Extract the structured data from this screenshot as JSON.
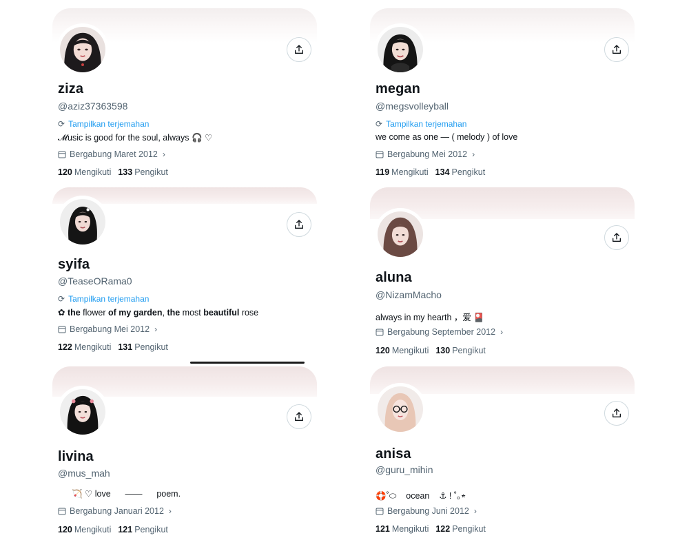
{
  "translate_label": "Tampilkan terjemahan",
  "following_label": "Mengikuti",
  "followers_label": "Pengikut",
  "icons": {
    "share": "share-icon",
    "translate": "translate-icon",
    "calendar": "calendar-icon",
    "chevron": "chevron-right-icon"
  },
  "profiles": [
    {
      "name": "ziza",
      "handle": "@aziz37363598",
      "bio": "𝓜usic is good for the soul, always 🎧 ♡",
      "joined": "Bergabung Maret 2012",
      "following": "120",
      "followers": "133"
    },
    {
      "name": "megan",
      "handle": "@megsvolleyball",
      "bio": "we come as one — ( melody ) of love",
      "joined": "Bergabung Mei 2012",
      "following": "119",
      "followers": "134"
    },
    {
      "name": "syifa",
      "handle": "@TeaseORama0",
      "bio_parts": [
        "✿ ",
        "the",
        " flower ",
        "of my garden",
        ", ",
        "the",
        " most ",
        "beautiful",
        " rose"
      ],
      "joined": "Bergabung Mei 2012",
      "following": "122",
      "followers": "131"
    },
    {
      "name": "aluna",
      "handle": "@NizamMacho",
      "bio": "always in my hearth ，爱 🎴",
      "joined": "Bergabung September 2012",
      "following": "120",
      "followers": "130"
    },
    {
      "name": "livina",
      "handle": "@mus_mah",
      "bio": "🏹 ♡ love      ——      poem.",
      "joined": "Bergabung Januari 2012",
      "following": "120",
      "followers": "121"
    },
    {
      "name": "anisa",
      "handle": "@guru_mihin",
      "bio": "🛟˚⬭    ocean    ⚓ ! ˚｡⭒",
      "joined": "Bergabung Juni 2012",
      "following": "121",
      "followers": "122"
    }
  ]
}
